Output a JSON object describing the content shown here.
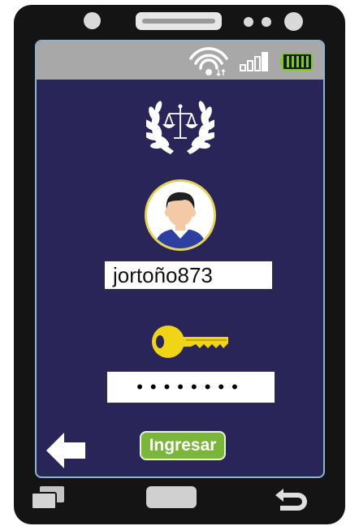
{
  "status_bar": {
    "wifi_icon": "wifi-icon",
    "signal_icon": "signal-bars-icon",
    "battery_icon": "battery-icon",
    "battery_color": "#7ecb1f"
  },
  "login": {
    "logo_icon": "scales-of-justice-laurel-icon",
    "avatar_icon": "user-avatar-icon",
    "username_value": "jortoño873",
    "key_icon": "key-icon",
    "password_value": "••••••••",
    "submit_label": "Ingresar",
    "back_icon": "back-arrow-icon"
  },
  "colors": {
    "screen_bg": "#2a2558",
    "status_bar_bg": "#a8a8a8",
    "button_bg": "#7ab63a",
    "key_color": "#f0d416",
    "avatar_ring": "#e6d35a"
  }
}
